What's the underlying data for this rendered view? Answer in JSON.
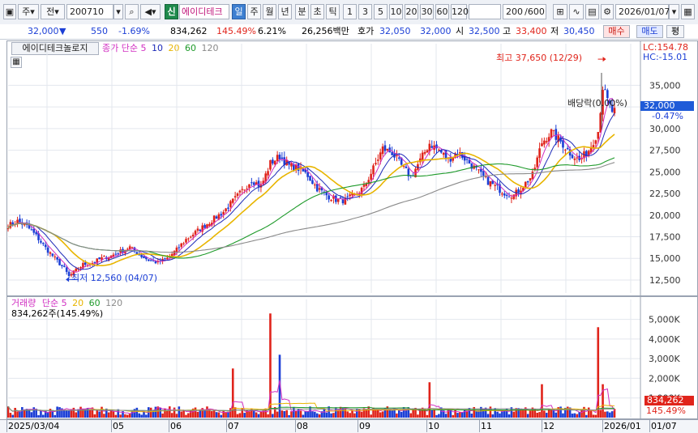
{
  "toolbar": {
    "market_label": "주",
    "period_label": "전",
    "code": "200710",
    "badge_new": "신",
    "stock_name": "에이디테크",
    "tab_day": "일",
    "tab_week": "주",
    "tab_month": "월",
    "tab_year": "년",
    "tab_minute": "분",
    "tab_second": "초",
    "tab_tick": "틱",
    "intervals": [
      "1",
      "3",
      "5",
      "10",
      "20",
      "30",
      "60",
      "120"
    ],
    "count": "200",
    "count_max": "/600",
    "date": "2026/01/07"
  },
  "quote": {
    "price": "32,000",
    "change": "550",
    "change_pct": "-1.69%",
    "volume": "834,262",
    "volume_ratio": "145.49%",
    "turnover": "6.21%",
    "amount": "26,256백만",
    "bid_label": "호가",
    "bid": "32,050",
    "ask": "32,000",
    "open_label": "시",
    "open": "32,500",
    "high_label": "고",
    "high": "33,400",
    "low_label": "저",
    "low": "30,450",
    "buy_button": "매수",
    "sell_button": "매도",
    "eval_button": "평"
  },
  "price_panel": {
    "indicator_tab": "에이디테크놀로지",
    "ma_label": "종가 단순",
    "ma_periods": [
      "5",
      "10",
      "20",
      "60",
      "120"
    ],
    "lc": "LC:154.78",
    "hc": "HC:-15.01",
    "current_price": "32,000",
    "current_pct": "-0.47%",
    "high_annotation": "최고 37,650 (12/29)",
    "low_annotation": "최저 12,560 (04/07)",
    "dividend_annotation": "배당락(0.00%)"
  },
  "volume_panel": {
    "title": "거래량",
    "ma_label": "단순",
    "ma_periods": [
      "5",
      "20",
      "60",
      "120"
    ],
    "current": "834,262주(145.49%)",
    "current_value": "834,262",
    "current_pct": "145.49%"
  },
  "x_axis": {
    "labels": [
      "2025/03/04",
      "05",
      "06",
      "07",
      "08",
      "09",
      "10",
      "11",
      "12",
      "2026/01",
      "01/07"
    ]
  },
  "colors": {
    "up": "#e0241b",
    "down": "#1c3fd6",
    "ma5": "#d12fc2",
    "ma10": "#1d2ab8",
    "ma20": "#e8b500",
    "ma60": "#1e9a2a",
    "ma120": "#8a8a8a",
    "price_box": "#1f5bd8",
    "volume_box": "#e0241b"
  },
  "chart_data": [
    {
      "type": "candlestick",
      "title": "에이디테크놀로지",
      "ylim": [
        11000,
        38500
      ],
      "y_ticks": [
        12500,
        15000,
        17500,
        20000,
        22500,
        25000,
        27500,
        30000,
        32500,
        35000
      ],
      "y_tick_labels": [
        "12,500",
        "15,000",
        "17,500",
        "20,000",
        "22,500",
        "25,000",
        "27,500",
        "30,000",
        "32,500",
        "35,000"
      ],
      "grid": true,
      "close_path": [
        [
          0,
          18800
        ],
        [
          4,
          19300
        ],
        [
          8,
          18700
        ],
        [
          12,
          17600
        ],
        [
          16,
          16200
        ],
        [
          20,
          15000
        ],
        [
          24,
          13800
        ],
        [
          26,
          12900
        ],
        [
          28,
          13400
        ],
        [
          32,
          14300
        ],
        [
          36,
          14500
        ],
        [
          40,
          15000
        ],
        [
          44,
          15300
        ],
        [
          48,
          15800
        ],
        [
          52,
          16300
        ],
        [
          56,
          15400
        ],
        [
          60,
          14800
        ],
        [
          64,
          14500
        ],
        [
          68,
          15000
        ],
        [
          72,
          16000
        ],
        [
          76,
          17200
        ],
        [
          80,
          18000
        ],
        [
          84,
          18800
        ],
        [
          88,
          19600
        ],
        [
          92,
          20400
        ],
        [
          96,
          21600
        ],
        [
          100,
          22800
        ],
        [
          104,
          24100
        ],
        [
          108,
          23300
        ],
        [
          112,
          26000
        ],
        [
          116,
          26800
        ],
        [
          120,
          25700
        ],
        [
          124,
          25400
        ],
        [
          128,
          24600
        ],
        [
          132,
          23100
        ],
        [
          136,
          22300
        ],
        [
          140,
          21800
        ],
        [
          144,
          21700
        ],
        [
          148,
          22300
        ],
        [
          152,
          23200
        ],
        [
          156,
          25400
        ],
        [
          160,
          27700
        ],
        [
          164,
          27200
        ],
        [
          168,
          25700
        ],
        [
          172,
          24400
        ],
        [
          176,
          26300
        ],
        [
          180,
          28300
        ],
        [
          184,
          27500
        ],
        [
          188,
          26400
        ],
        [
          192,
          27300
        ],
        [
          196,
          26300
        ],
        [
          200,
          25200
        ],
        [
          204,
          24100
        ],
        [
          208,
          23300
        ],
        [
          212,
          22600
        ],
        [
          216,
          22300
        ],
        [
          220,
          23400
        ],
        [
          224,
          24600
        ],
        [
          228,
          28400
        ],
        [
          232,
          29600
        ],
        [
          236,
          28500
        ],
        [
          240,
          27200
        ],
        [
          244,
          26300
        ],
        [
          248,
          27500
        ],
        [
          252,
          29700
        ],
        [
          254,
          34800
        ],
        [
          256,
          33200
        ],
        [
          258,
          32000
        ]
      ],
      "ma_summary": {
        "ma5_end": 32000,
        "ma10_end": 31000,
        "ma20_end": 29900,
        "ma60_end": 27000,
        "ma120_end": 25300
      }
    },
    {
      "type": "bar",
      "title": "거래량",
      "ylim": [
        0,
        5600000
      ],
      "y_ticks": [
        1000000,
        2000000,
        3000000,
        4000000,
        5000000
      ],
      "y_tick_labels": [
        "1,000K",
        "2,000K",
        "3,000K",
        "4,000K",
        "5,000K"
      ],
      "spikes": [
        [
          112,
          5300000
        ],
        [
          116,
          3200000
        ],
        [
          96,
          2500000
        ],
        [
          180,
          1800000
        ],
        [
          228,
          1700000
        ],
        [
          252,
          4600000
        ],
        [
          254,
          1700000
        ]
      ],
      "baseline_volume": 350000
    }
  ]
}
